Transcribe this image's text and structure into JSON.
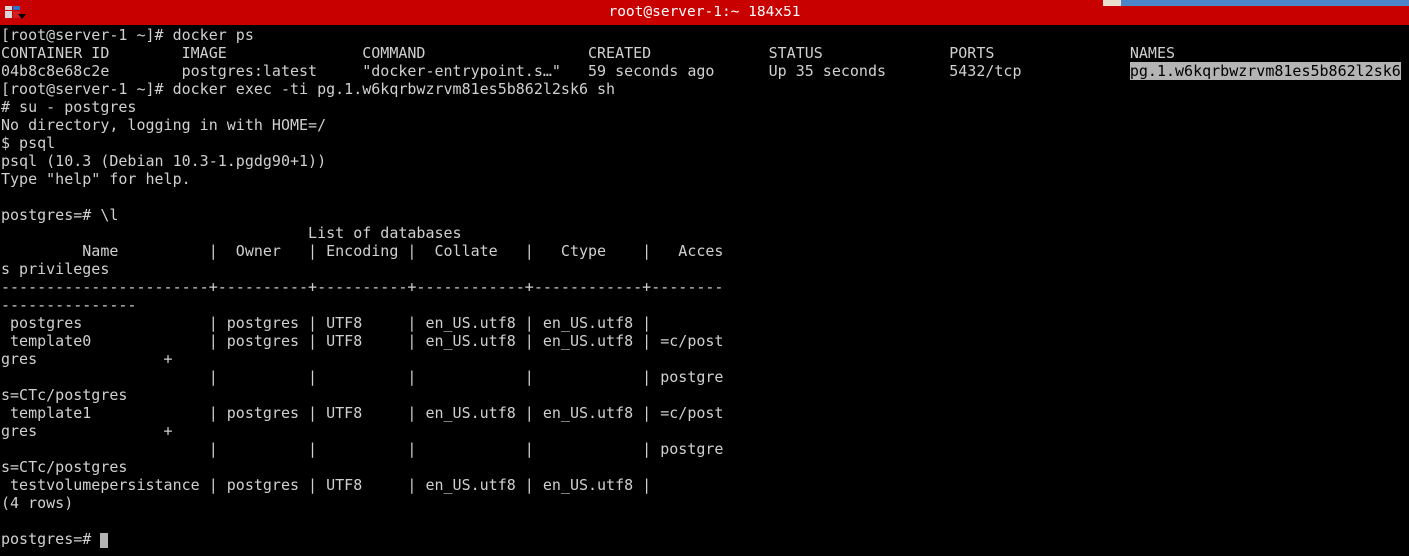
{
  "window": {
    "title": "root@server-1:~ 184x51",
    "icon_name": "window-menu-icon",
    "titlebar_color": "#c80000",
    "terminal_bg": "#000000",
    "terminal_fg": "#d0d0d0",
    "selection_bg": "#b4b4b4",
    "selection_fg": "#000000",
    "cols": 184,
    "rows": 51
  },
  "terminal": {
    "lines": [
      {
        "id": "line-01",
        "text": "[root@server-1 ~]# docker ps"
      },
      {
        "id": "line-02",
        "text": "CONTAINER ID        IMAGE               COMMAND                  CREATED             STATUS              PORTS               NAMES"
      },
      {
        "id": "line-03",
        "pre": "04b8c8e68c2e        postgres:latest     \"docker-entrypoint.s…\"   59 seconds ago      Up 35 seconds       5432/tcp            ",
        "highlight": "pg.1.w6kqrbwzrvm81es5b862l2sk6"
      },
      {
        "id": "line-04",
        "text": "[root@server-1 ~]# docker exec -ti pg.1.w6kqrbwzrvm81es5b862l2sk6 sh"
      },
      {
        "id": "line-05",
        "text": "# su - postgres"
      },
      {
        "id": "line-06",
        "text": "No directory, logging in with HOME=/"
      },
      {
        "id": "line-07",
        "text": "$ psql"
      },
      {
        "id": "line-08",
        "text": "psql (10.3 (Debian 10.3-1.pgdg90+1))"
      },
      {
        "id": "line-09",
        "text": "Type \"help\" for help."
      },
      {
        "id": "line-10",
        "text": ""
      },
      {
        "id": "line-11",
        "text": "postgres=# \\l"
      },
      {
        "id": "line-12",
        "text": "                                  List of databases"
      },
      {
        "id": "line-13",
        "text": "         Name          |  Owner   | Encoding |  Collate   |   Ctype    |   Acces"
      },
      {
        "id": "line-14",
        "text": "s privileges"
      },
      {
        "id": "line-15",
        "text": "-----------------------+----------+----------+------------+------------+--------"
      },
      {
        "id": "line-16",
        "text": "---------------"
      },
      {
        "id": "line-17",
        "text": " postgres              | postgres | UTF8     | en_US.utf8 | en_US.utf8 |"
      },
      {
        "id": "line-18",
        "text": " template0             | postgres | UTF8     | en_US.utf8 | en_US.utf8 | =c/post"
      },
      {
        "id": "line-19",
        "text": "gres              +"
      },
      {
        "id": "line-20",
        "text": "                       |          |          |            |            | postgre"
      },
      {
        "id": "line-21",
        "text": "s=CTc/postgres"
      },
      {
        "id": "line-22",
        "text": " template1             | postgres | UTF8     | en_US.utf8 | en_US.utf8 | =c/post"
      },
      {
        "id": "line-23",
        "text": "gres              +"
      },
      {
        "id": "line-24",
        "text": "                       |          |          |            |            | postgre"
      },
      {
        "id": "line-25",
        "text": "s=CTc/postgres"
      },
      {
        "id": "line-26",
        "text": " testvolumepersistance | postgres | UTF8     | en_US.utf8 | en_US.utf8 |"
      },
      {
        "id": "line-27",
        "text": "(4 rows)"
      },
      {
        "id": "line-28",
        "text": ""
      },
      {
        "id": "line-29",
        "prompt": "postgres=# ",
        "cursor": true
      }
    ]
  },
  "docker_ps": {
    "headers": [
      "CONTAINER ID",
      "IMAGE",
      "COMMAND",
      "CREATED",
      "STATUS",
      "PORTS",
      "NAMES"
    ],
    "rows": [
      {
        "container_id": "04b8c8e68c2e",
        "image": "postgres:latest",
        "command": "\"docker-entrypoint.s…\"",
        "created": "59 seconds ago",
        "status": "Up 35 seconds",
        "ports": "5432/tcp",
        "names": "pg.1.w6kqrbwzrvm81es5b862l2sk6"
      }
    ]
  },
  "psql": {
    "version_banner": "psql (10.3 (Debian 10.3-1.pgdg90+1))",
    "help_hint": "Type \"help\" for help.",
    "table_title": "List of databases",
    "headers": [
      "Name",
      "Owner",
      "Encoding",
      "Collate",
      "Ctype",
      "Access privileges"
    ],
    "rows": [
      {
        "name": "postgres",
        "owner": "postgres",
        "encoding": "UTF8",
        "collate": "en_US.utf8",
        "ctype": "en_US.utf8",
        "access_privileges": ""
      },
      {
        "name": "template0",
        "owner": "postgres",
        "encoding": "UTF8",
        "collate": "en_US.utf8",
        "ctype": "en_US.utf8",
        "access_privileges": "=c/postgres              +postgres=CTc/postgres"
      },
      {
        "name": "template1",
        "owner": "postgres",
        "encoding": "UTF8",
        "collate": "en_US.utf8",
        "ctype": "en_US.utf8",
        "access_privileges": "=c/postgres              +postgres=CTc/postgres"
      },
      {
        "name": "testvolumepersistance",
        "owner": "postgres",
        "encoding": "UTF8",
        "collate": "en_US.utf8",
        "ctype": "en_US.utf8",
        "access_privileges": ""
      }
    ],
    "row_count_label": "(4 rows)",
    "prompt": "postgres=# "
  },
  "commands": [
    "docker ps",
    "docker exec -ti pg.1.w6kqrbwzrvm81es5b862l2sk6 sh",
    "su - postgres",
    "psql",
    "\\l"
  ]
}
